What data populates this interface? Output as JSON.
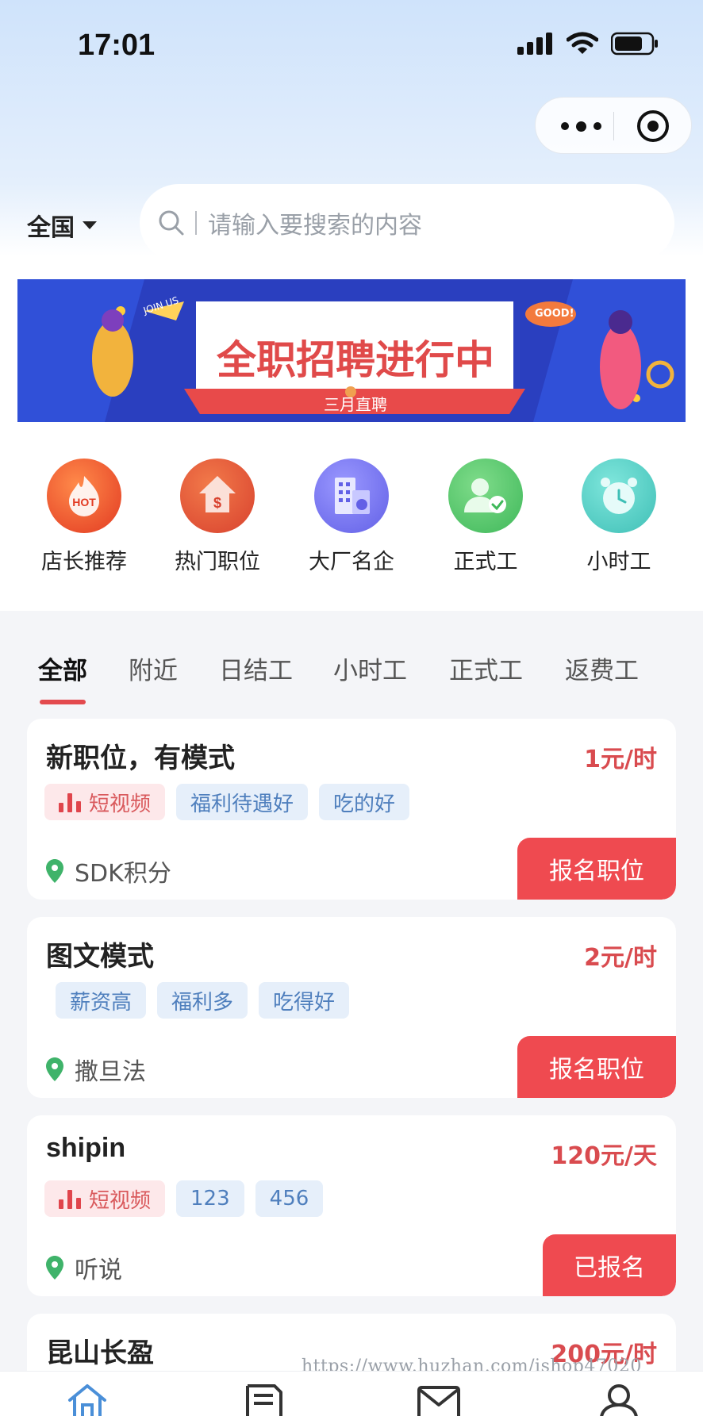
{
  "status_bar": {
    "time": "17:01"
  },
  "header": {
    "region": "全国",
    "search_placeholder": "请输入要搜索的内容"
  },
  "banner": {
    "title": "全职招聘进行中",
    "subtitle": "三月直聘",
    "badge_left": "JOIN US",
    "badge_right": "GOOD!"
  },
  "quick_links": [
    {
      "label": "店长推荐",
      "icon": "hot-icon",
      "color": "#e8452c"
    },
    {
      "label": "热门职位",
      "icon": "money-house-icon",
      "color": "#e04a32"
    },
    {
      "label": "大厂名企",
      "icon": "building-icon",
      "color": "#6f6ef0"
    },
    {
      "label": "正式工",
      "icon": "user-check-icon",
      "color": "#4fc36a"
    },
    {
      "label": "小时工",
      "icon": "alarm-clock-icon",
      "color": "#4cc9c1"
    }
  ],
  "tabs": [
    "全部",
    "附近",
    "日结工",
    "小时工",
    "正式工",
    "返费工"
  ],
  "jobs": [
    {
      "title": "新职位，有模式",
      "price": "1元/时",
      "tags": [
        {
          "text": "短视频",
          "style": "red",
          "icon": "bar-chart-icon"
        },
        {
          "text": "福利待遇好",
          "style": "blue"
        },
        {
          "text": "吃的好",
          "style": "blue"
        }
      ],
      "location": "SDK积分",
      "action": "报名职位"
    },
    {
      "title": "图文模式",
      "price": "2元/时",
      "tags": [
        {
          "text": "薪资高",
          "style": "blue"
        },
        {
          "text": "福利多",
          "style": "blue"
        },
        {
          "text": "吃得好",
          "style": "blue"
        }
      ],
      "location": "撒旦法",
      "action": "报名职位"
    },
    {
      "title": "shipin",
      "price": "120元/天",
      "tags": [
        {
          "text": "短视频",
          "style": "red",
          "icon": "bar-chart-icon"
        },
        {
          "text": "123",
          "style": "blue"
        },
        {
          "text": "456",
          "style": "blue"
        }
      ],
      "location": "听说",
      "action": "已报名"
    },
    {
      "title": "昆山长盈",
      "price": "200元/时"
    }
  ],
  "watermark": "https://www.huzhan.com/ishop47020",
  "bottom_nav": [
    "home-icon",
    "document-icon",
    "mail-icon",
    "user-icon"
  ],
  "colors": {
    "accent": "#ef4a50",
    "price": "#d94b4f",
    "tag_blue": "#4f7fbd",
    "location": "#3fb36a"
  }
}
